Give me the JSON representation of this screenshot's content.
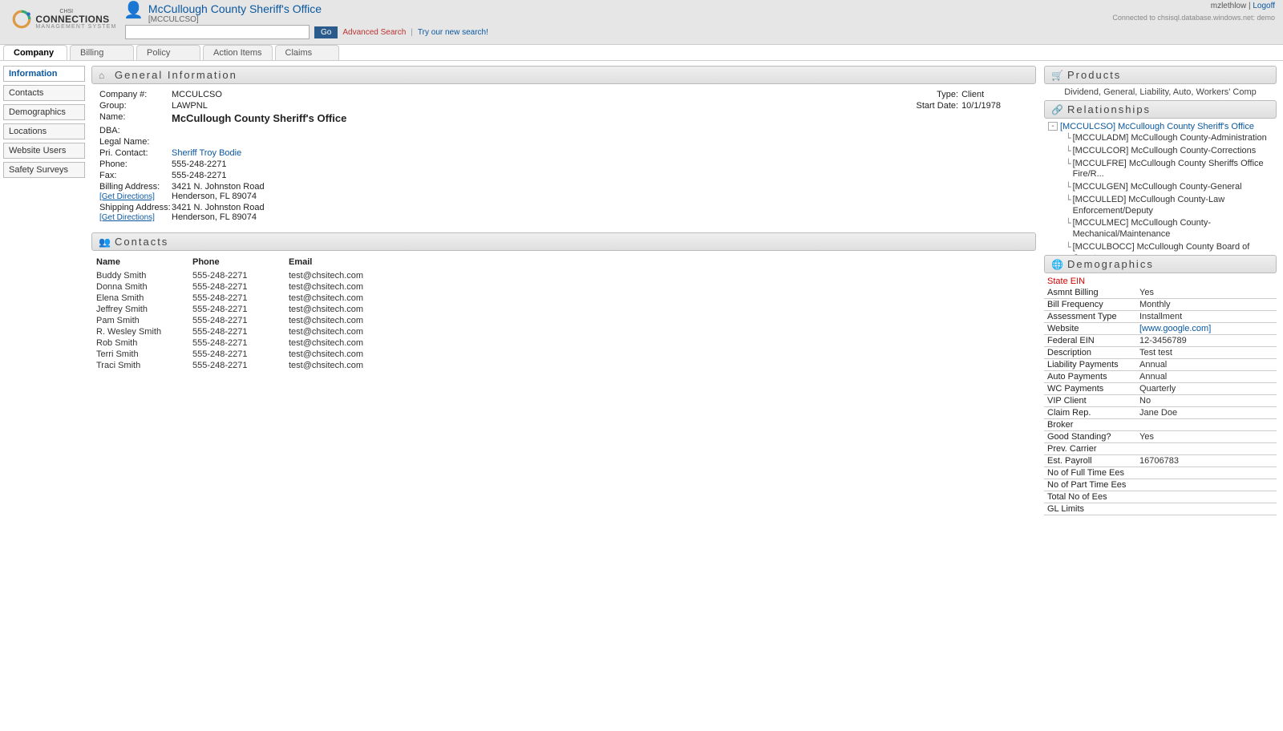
{
  "header": {
    "brand_chsi": "CHSI",
    "brand_main": "CONNECTIONS",
    "brand_sub": "MANAGEMENT SYSTEM",
    "company_title": "McCullough County Sheriff's Office",
    "company_code": "[MCCULCSO]",
    "go_label": "Go",
    "advanced_search": "Advanced Search",
    "try_new": "Try our new search!",
    "username": "mzlethlow",
    "logoff": "Logoff",
    "connected": "Connected to chsisql.database.windows.net: demo"
  },
  "tabs": [
    {
      "label": "Company",
      "active": true
    },
    {
      "label": "Billing",
      "active": false
    },
    {
      "label": "Policy",
      "active": false
    },
    {
      "label": "Action Items",
      "active": false
    },
    {
      "label": "Claims",
      "active": false
    }
  ],
  "sidebar": [
    {
      "label": "Information",
      "active": true
    },
    {
      "label": "Contacts",
      "active": false
    },
    {
      "label": "Demographics",
      "active": false
    },
    {
      "label": "Locations",
      "active": false
    },
    {
      "label": "Website Users",
      "active": false
    },
    {
      "label": "Safety Surveys",
      "active": false
    }
  ],
  "general_info": {
    "title": "General Information",
    "labels": {
      "company_no": "Company #:",
      "group": "Group:",
      "name": "Name:",
      "dba": "DBA:",
      "legal_name": "Legal Name:",
      "pri_contact": "Pri. Contact:",
      "phone": "Phone:",
      "fax": "Fax:",
      "billing_addr": "Billing Address:",
      "shipping_addr": "Shipping Address:",
      "get_directions": "[Get Directions]",
      "type": "Type:",
      "start_date": "Start Date:"
    },
    "values": {
      "company_no": "MCCULCSO",
      "group": "LAWPNL",
      "name": "McCullough County Sheriff's Office",
      "dba": "",
      "legal_name": "",
      "pri_contact": "Sheriff Troy Bodie",
      "phone": "555-248-2271",
      "fax": "555-248-2271",
      "billing_addr_l1": "3421 N. Johnston Road",
      "billing_addr_l2": "Henderson, FL 89074",
      "shipping_addr_l1": "3421 N. Johnston Road",
      "shipping_addr_l2": "Henderson, FL 89074",
      "type": "Client",
      "start_date": "10/1/1978"
    }
  },
  "contacts": {
    "title": "Contacts",
    "headers": {
      "name": "Name",
      "phone": "Phone",
      "email": "Email"
    },
    "rows": [
      {
        "name": "Buddy Smith",
        "phone": "555-248-2271",
        "email": "test@chsitech.com"
      },
      {
        "name": "Donna Smith",
        "phone": "555-248-2271",
        "email": "test@chsitech.com"
      },
      {
        "name": "Elena Smith",
        "phone": "555-248-2271",
        "email": "test@chsitech.com"
      },
      {
        "name": "Jeffrey Smith",
        "phone": "555-248-2271",
        "email": "test@chsitech.com"
      },
      {
        "name": "Pam Smith",
        "phone": "555-248-2271",
        "email": "test@chsitech.com"
      },
      {
        "name": "R. Wesley Smith",
        "phone": "555-248-2271",
        "email": "test@chsitech.com"
      },
      {
        "name": "Rob Smith",
        "phone": "555-248-2271",
        "email": "test@chsitech.com"
      },
      {
        "name": "Terri Smith",
        "phone": "555-248-2271",
        "email": "test@chsitech.com"
      },
      {
        "name": "Traci Smith",
        "phone": "555-248-2271",
        "email": "test@chsitech.com"
      }
    ]
  },
  "products": {
    "title": "Products",
    "text": "Dividend, General, Liability, Auto, Workers' Comp"
  },
  "relationships": {
    "title": "Relationships",
    "root": "[MCCULCSO] McCullough County Sheriff's Office",
    "children": [
      "[MCCULADM] McCullough County-Administration",
      "[MCCULCOR] McCullough County-Corrections",
      "[MCCULFRE] McCullough County Sheriffs Office Fire/R...",
      "[MCCULGEN] McCullough County-General",
      "[MCCULLED] McCullough County-Law Enforcement/Deputy",
      "[MCCULMEC] McCullough County-Mechanical/Maintenance",
      "[MCCULBOCC] McCullough County Board of County"
    ]
  },
  "demographics": {
    "title": "Demographics",
    "warning": "State EIN",
    "rows": [
      {
        "label": "Asmnt Billing",
        "value": "Yes"
      },
      {
        "label": "Bill Frequency",
        "value": "Monthly"
      },
      {
        "label": "Assessment Type",
        "value": "Installment"
      },
      {
        "label": "Website",
        "value": "[www.google.com]",
        "link": true
      },
      {
        "label": "Federal EIN",
        "value": "12-3456789"
      },
      {
        "label": "Description",
        "value": "Test test"
      },
      {
        "label": "Liability Payments",
        "value": "Annual"
      },
      {
        "label": "Auto Payments",
        "value": "Annual"
      },
      {
        "label": "WC Payments",
        "value": "Quarterly"
      },
      {
        "label": "VIP Client",
        "value": "No"
      },
      {
        "label": "Claim Rep.",
        "value": "Jane Doe"
      },
      {
        "label": "Broker",
        "value": ""
      },
      {
        "label": "Good Standing?",
        "value": "Yes"
      },
      {
        "label": "Prev. Carrier",
        "value": ""
      },
      {
        "label": "Est. Payroll",
        "value": "16706783"
      },
      {
        "label": "No of Full Time Ees",
        "value": ""
      },
      {
        "label": "No of Part Time Ees",
        "value": ""
      },
      {
        "label": "Total No of Ees",
        "value": ""
      },
      {
        "label": "GL Limits",
        "value": ""
      }
    ]
  }
}
